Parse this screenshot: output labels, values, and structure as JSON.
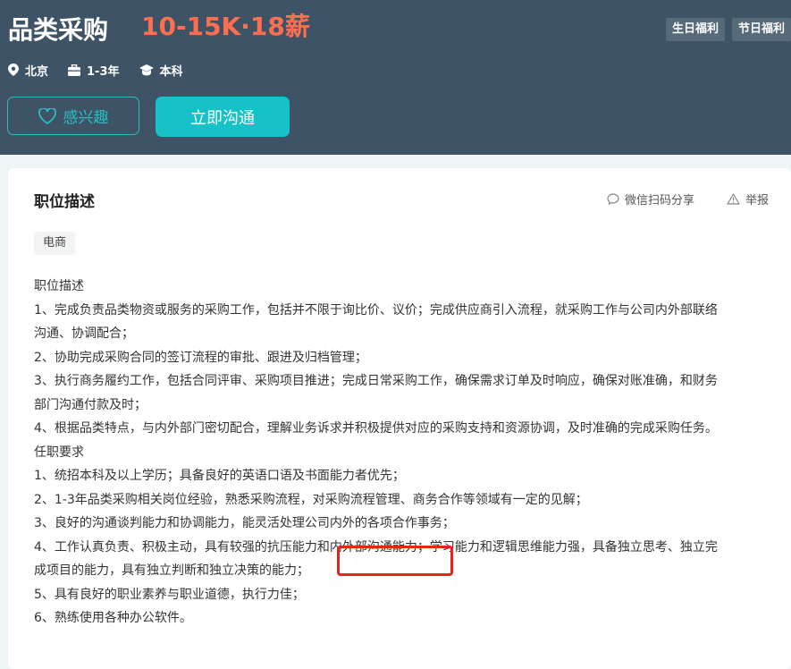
{
  "header": {
    "title": "品类采购",
    "salary": "10-15K·18薪",
    "benefit_tags": [
      "生日福利",
      "节日福利"
    ],
    "meta": {
      "location": "北京",
      "experience": "1-3年",
      "education": "本科"
    },
    "interest_label": "感兴趣",
    "chat_label": "立即沟通"
  },
  "section": {
    "title": "职位描述",
    "share_label": "微信扫码分享",
    "report_label": "举报",
    "category_tag": "电商"
  },
  "description": [
    "职位描述",
    "1、完成负责品类物资或服务的采购工作，包括并不限于询比价、议价；完成供应商引入流程，就采购工作与公司内外部联络",
    "沟通、协调配合；",
    "2、协助完成采购合同的签订流程的审批、跟进及归档管理；",
    "3、执行商务履约工作，包括合同评审、采购项目推进；完成日常采购工作，确保需求订单及时响应，确保对账准确，和财务",
    "部门沟通付款及时；",
    "4、根据品类特点，与内外部门密切配合，理解业务诉求并积极提供对应的采购支持和资源协调，及时准确的完成采购任务。",
    "任职要求",
    "1、统招本科及以上学历；具备良好的英语口语及书面能力者优先；",
    "2、1-3年品类采购相关岗位经验，熟悉采购流程，对采购流程管理、商务合作等领域有一定的见解；",
    "3、良好的沟通谈判能力和协调能力，能灵活处理公司内外的各项合作事务；",
    "4、工作认真负责、积极主动，具有较强的抗压能力和内外部沟通能力；学习能力和逻辑思维能力强，具备独立思考、独立完",
    "成项目的能力，具有独立判断和独立决策的能力；",
    "5、具有良好的职业素养与职业道德，执行力佳；",
    "6、熟练使用各种办公软件。"
  ],
  "colors": {
    "header_bg": "#3e5466",
    "salary": "#fe6f52",
    "accent": "#16c2c7",
    "highlight_box": "#e8231e"
  }
}
